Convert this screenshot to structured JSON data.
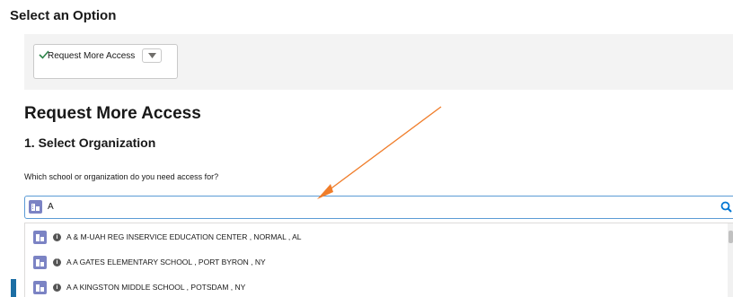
{
  "option_section": {
    "title": "Select an Option",
    "selected_value": "Request More Access",
    "selected_icon": "checkmark-icon",
    "check_color": "#2e844a"
  },
  "main": {
    "heading": "Request More Access",
    "step_heading": "1. Select Organization",
    "question": "Which school or organization do you need access for?"
  },
  "search": {
    "value": "A",
    "leading_icon": "organization-icon",
    "trailing_icon": "search-icon",
    "accent_color": "#0176d3"
  },
  "results": [
    {
      "label": "A & M-UAH REG INSERVICE EDUCATION CENTER , NORMAL , AL"
    },
    {
      "label": "A A GATES ELEMENTARY SCHOOL , PORT BYRON , NY"
    },
    {
      "label": "A A KINGSTON MIDDLE SCHOOL , POTSDAM , NY"
    }
  ],
  "annotation": {
    "type": "arrow",
    "color": "#f07d2a",
    "points_to": "search-input"
  }
}
